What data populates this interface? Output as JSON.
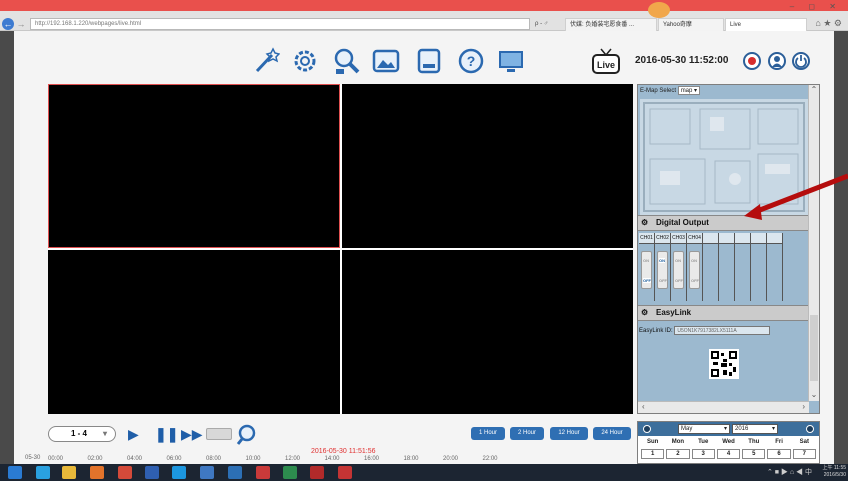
{
  "browser": {
    "url": "http://192.168.1.220/webpages/live.html",
    "url_tools": "ρ - ♂",
    "tabs": [
      {
        "label": "伏媒: 负婚装宅愿食番 ..."
      },
      {
        "label": "Yahoo奇摩"
      },
      {
        "label": "Live"
      }
    ],
    "window_controls": "– ◻ ✕",
    "fav_icons": "⌂ ★ ⚙"
  },
  "toolbar": {
    "icons": [
      "wand-icon",
      "settings-gear-icon",
      "search-person-icon",
      "image-icon",
      "storage-icon",
      "help-icon",
      "monitor-icon"
    ],
    "live_label": "Live",
    "datetime": "2016-05-30 11:52:00",
    "buttons": [
      "record-icon",
      "user-icon",
      "power-icon"
    ]
  },
  "colors": {
    "accent": "#2f6fb3",
    "panel_bg": "#9cb9cf",
    "selected_cell_border": "#e05050",
    "timestamp_red": "#e03030",
    "arrow_red": "#b50d0d"
  },
  "side_panel": {
    "emap_label": "E-Map Select",
    "emap_value": "map",
    "digital_output_title": "Digital Output",
    "channels": [
      {
        "label": "CH01",
        "state": "OFF"
      },
      {
        "label": "CH02",
        "state": "ON"
      },
      {
        "label": "CH03",
        "state": "ON"
      },
      {
        "label": "CH04",
        "state": "ON"
      }
    ],
    "on_text": "ON",
    "off_text": "OFF",
    "easylink_title": "EasyLink",
    "easylink_label": "EasyLink ID:",
    "easylink_id": "U5ON1K7917382LX5111A"
  },
  "controls": {
    "page_value": "1 - 4",
    "hour_buttons": [
      "1 Hour",
      "2 Hour",
      "12 Hour",
      "24 Hour"
    ]
  },
  "timeline": {
    "timestamp": "2016-05-30 11:51:56",
    "date": "05-30",
    "ticks": [
      "00:00",
      "02:00",
      "04:00",
      "06:00",
      "08:00",
      "10:00",
      "12:00",
      "14:00",
      "16:00",
      "18:00",
      "20:00",
      "22:00"
    ]
  },
  "calendar": {
    "month": "May",
    "year": "2016",
    "weekdays": [
      "Sun",
      "Mon",
      "Tue",
      "Wed",
      "Thu",
      "Fri",
      "Sat"
    ],
    "first_week": [
      "1",
      "2",
      "3",
      "4",
      "5",
      "6",
      "7"
    ]
  },
  "taskbar": {
    "clock_time": "上午 11:55",
    "clock_date": "2016/5/30",
    "tray": "⌃ ■ ▶ ⌂ ◀ 中"
  }
}
